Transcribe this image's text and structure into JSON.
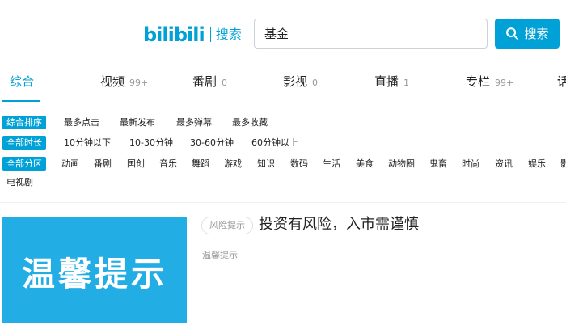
{
  "header": {
    "logo_text": "bilibili",
    "logo_subtitle": "搜索",
    "brand_color": "#00a1d6"
  },
  "search": {
    "value": "基金",
    "button_label": "搜索",
    "button_icon": "search-icon"
  },
  "tabs": [
    {
      "label": "综合",
      "count": "",
      "active": true
    },
    {
      "label": "视频",
      "count": "99+"
    },
    {
      "label": "番剧",
      "count": "0"
    },
    {
      "label": "影视",
      "count": "0"
    },
    {
      "label": "直播",
      "count": "1"
    },
    {
      "label": "专栏",
      "count": "99+"
    },
    {
      "label": "话",
      "count": ""
    }
  ],
  "filters": {
    "sort": {
      "tag": "综合排序",
      "options": [
        "最多点击",
        "最新发布",
        "最多弹幕",
        "最多收藏"
      ]
    },
    "duration": {
      "tag": "全部时长",
      "options": [
        "10分钟以下",
        "10-30分钟",
        "30-60分钟",
        "60分钟以上"
      ]
    },
    "zone": {
      "tag": "全部分区",
      "options": [
        "动画",
        "番剧",
        "国创",
        "音乐",
        "舞蹈",
        "游戏",
        "知识",
        "数码",
        "生活",
        "美食",
        "动物圈",
        "鬼畜",
        "时尚",
        "资讯",
        "娱乐",
        "影",
        "电视剧"
      ]
    }
  },
  "result": {
    "thumbnail_text": "温馨提示",
    "badge": "风险提示",
    "title": "投资有风险，入市需谨慎",
    "description": "温馨提示"
  }
}
